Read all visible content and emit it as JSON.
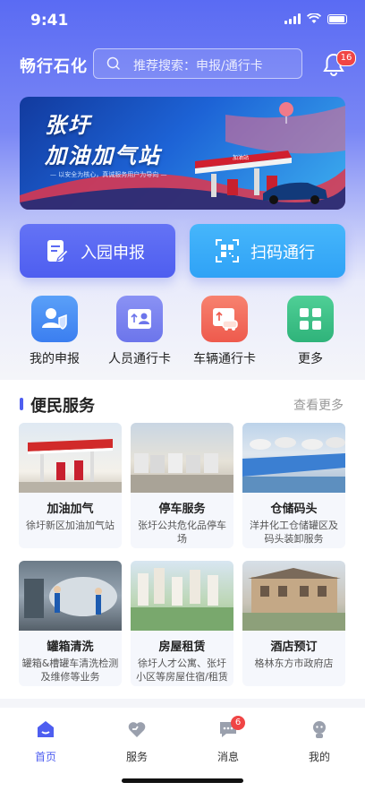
{
  "status": {
    "time": "9:41"
  },
  "header": {
    "title": "畅行石化",
    "search_placeholder": "推荐搜索：申报/通行卡",
    "notification_count": "16"
  },
  "banner": {
    "line1": "张圩",
    "line2": "加油加气站",
    "slogan": "— 以安全为核心，真诚服务用户为导向 —",
    "station_sign": "加油站"
  },
  "actions": {
    "declare": "入园申报",
    "scan": "扫码通行"
  },
  "quick_links": [
    {
      "label": "我的申报",
      "icon": "user-shield-icon",
      "color": "#4a8ef5"
    },
    {
      "label": "人员通行卡",
      "icon": "person-card-icon",
      "color": "#7b84ef"
    },
    {
      "label": "车辆通行卡",
      "icon": "car-card-icon",
      "color": "#f26b5d"
    },
    {
      "label": "更多",
      "icon": "grid-icon",
      "color": "#3cc08a"
    }
  ],
  "services": {
    "title": "便民服务",
    "more": "查看更多",
    "cards": [
      {
        "title": "加油加气",
        "desc": "徐圩新区加油加气站"
      },
      {
        "title": "停车服务",
        "desc": "张圩公共危化品停车场"
      },
      {
        "title": "仓储码头",
        "desc": "洋井化工仓储罐区及码头装卸服务"
      },
      {
        "title": "罐箱清洗",
        "desc": "罐箱&槽罐车清洗检测及维修等业务"
      },
      {
        "title": "房屋租赁",
        "desc": "徐圩人才公寓、张圩小区等房屋住宿/租赁"
      },
      {
        "title": "酒店预订",
        "desc": "格林东方市政府店"
      }
    ]
  },
  "tabbar": {
    "home": "首页",
    "service": "服务",
    "messages": "消息",
    "me": "我的",
    "messages_badge": "6"
  },
  "colors": {
    "accent": "#4e5ef0",
    "secondary": "#2fa2f6",
    "badge": "#f04545"
  }
}
